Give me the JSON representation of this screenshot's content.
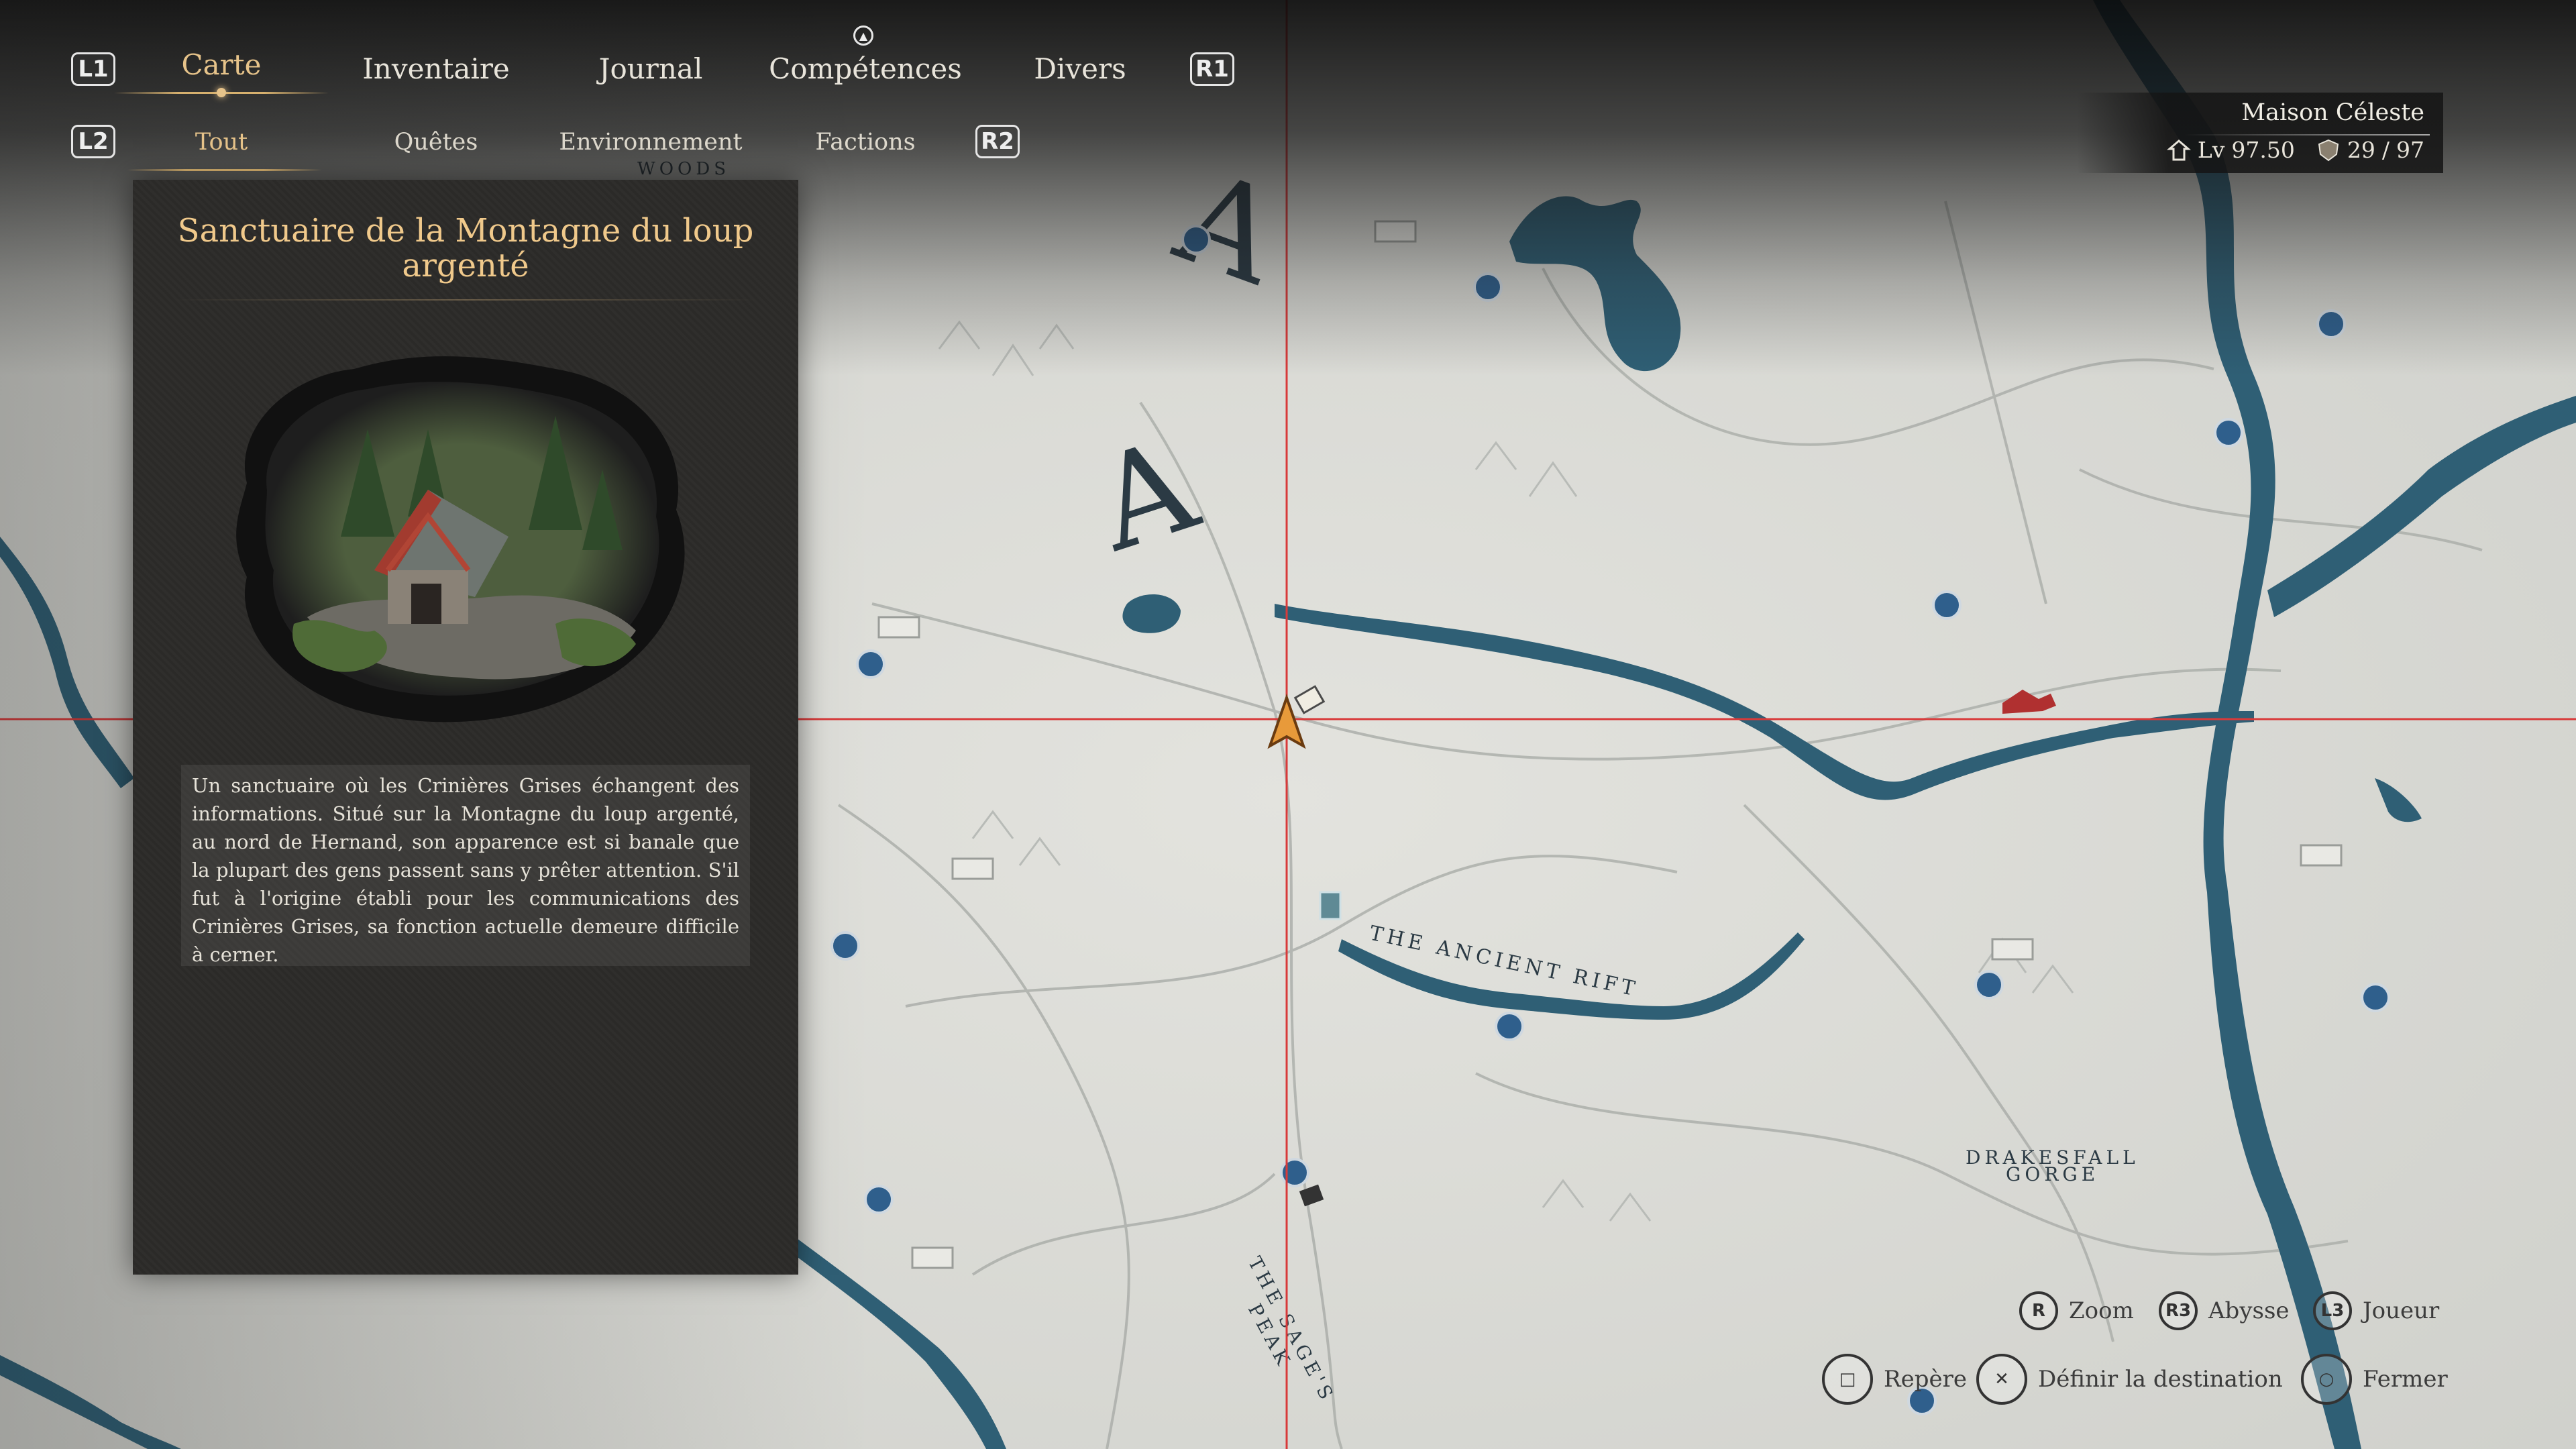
{
  "top_tabs": {
    "left_button": "L1",
    "right_button": "R1",
    "items": [
      {
        "label": "Carte",
        "active": true
      },
      {
        "label": "Inventaire",
        "active": false
      },
      {
        "label": "Journal",
        "active": false
      },
      {
        "label": "Compétences",
        "active": false
      },
      {
        "label": "Divers",
        "active": false
      }
    ]
  },
  "filter_tabs": {
    "left_button": "L2",
    "right_button": "R2",
    "items": [
      {
        "label": "Tout",
        "active": true
      },
      {
        "label": "Quêtes",
        "active": false
      },
      {
        "label": "Environnement",
        "active": false
      },
      {
        "label": "Factions",
        "active": false
      }
    ]
  },
  "info_panel": {
    "title": "Sanctuaire de la Montagne du loup argenté",
    "description": "Un sanctuaire où les Crinières Grises échangent des informations. Situé sur la Montagne du loup argenté, au nord de Hernand, son apparence est si banale que la plupart des gens passent sans y prêter attention. S'il fut à l'origine établi pour les communications des Crinières Grises, sa fonction actuelle demeure difficile à cerner."
  },
  "save_info": {
    "name": "Maison Céleste",
    "level_label": "Lv",
    "level": "97.50",
    "count": "29",
    "separator": "/",
    "total": "97"
  },
  "map_labels": {
    "woods": "WOODS",
    "rift": "THE ANCIENT RIFT",
    "gorge_line1": "DRAKESFALL",
    "gorge_line2": "GORGE",
    "peak_line1": "THE SAGE'S",
    "peak_line2": "PEAK",
    "letter1": "A",
    "letter2": "A"
  },
  "controls": [
    {
      "button": "R",
      "label": "Zoom"
    },
    {
      "button": "R3",
      "label": "Abysse"
    },
    {
      "button": "L3",
      "label": "Joueur"
    },
    {
      "button": "□",
      "label": "Repère"
    },
    {
      "button": "✕",
      "label": "Définir la destination"
    },
    {
      "button": "○",
      "label": "Fermer"
    }
  ],
  "colors": {
    "accent_gold": "#e6c38a",
    "water": "#2f5f75",
    "crosshair": "#d83a3a",
    "map_paper": "#d9d9d4"
  }
}
